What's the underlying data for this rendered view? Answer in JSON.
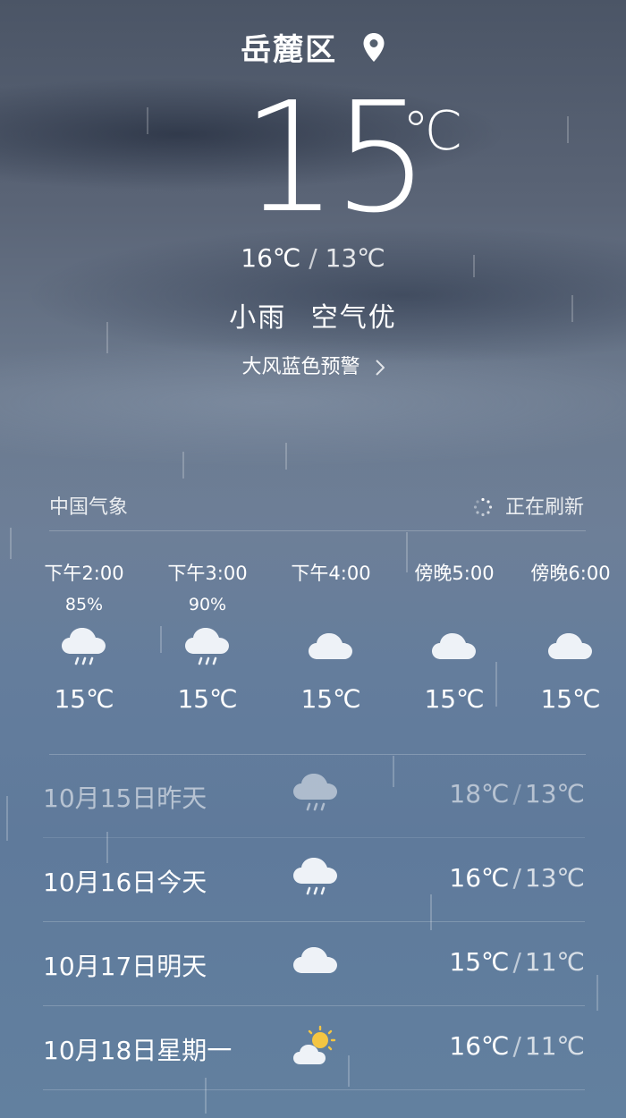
{
  "location": {
    "name": "岳麓区",
    "icon": "location-pin-icon"
  },
  "current": {
    "temp": "15",
    "unit": "℃",
    "high": "16℃",
    "separator": "/",
    "low": "13℃",
    "condition": "小雨",
    "air_quality": "空气优",
    "warning": "大风蓝色预警"
  },
  "source": {
    "name": "中国气象",
    "refresh_label": "正在刷新"
  },
  "hourly": [
    {
      "time": "下午2:00",
      "precip": "85%",
      "icon": "rain-cloud-icon",
      "temp": "15℃"
    },
    {
      "time": "下午3:00",
      "precip": "90%",
      "icon": "rain-cloud-icon",
      "temp": "15℃"
    },
    {
      "time": "下午4:00",
      "precip": "",
      "icon": "cloud-icon",
      "temp": "15℃"
    },
    {
      "time": "傍晚5:00",
      "precip": "",
      "icon": "cloud-icon",
      "temp": "15℃"
    },
    {
      "time": "傍晚6:00",
      "precip": "",
      "icon": "cloud-icon",
      "temp": "15℃"
    }
  ],
  "daily": [
    {
      "date": "10月15日昨天",
      "icon": "rain-cloud-icon",
      "high": "18℃",
      "sep": "/",
      "low": "13℃"
    },
    {
      "date": "10月16日今天",
      "icon": "rain-cloud-icon",
      "high": "16℃",
      "sep": "/",
      "low": "13℃"
    },
    {
      "date": "10月17日明天",
      "icon": "cloud-icon",
      "high": "15℃",
      "sep": "/",
      "low": "11℃"
    },
    {
      "date": "10月18日星期一",
      "icon": "partly-sunny-icon",
      "high": "16℃",
      "sep": "/",
      "low": "11℃"
    }
  ],
  "colors": {
    "text": "#ffffff",
    "sun": "#f4c542",
    "cloud": "#eef2f7"
  }
}
